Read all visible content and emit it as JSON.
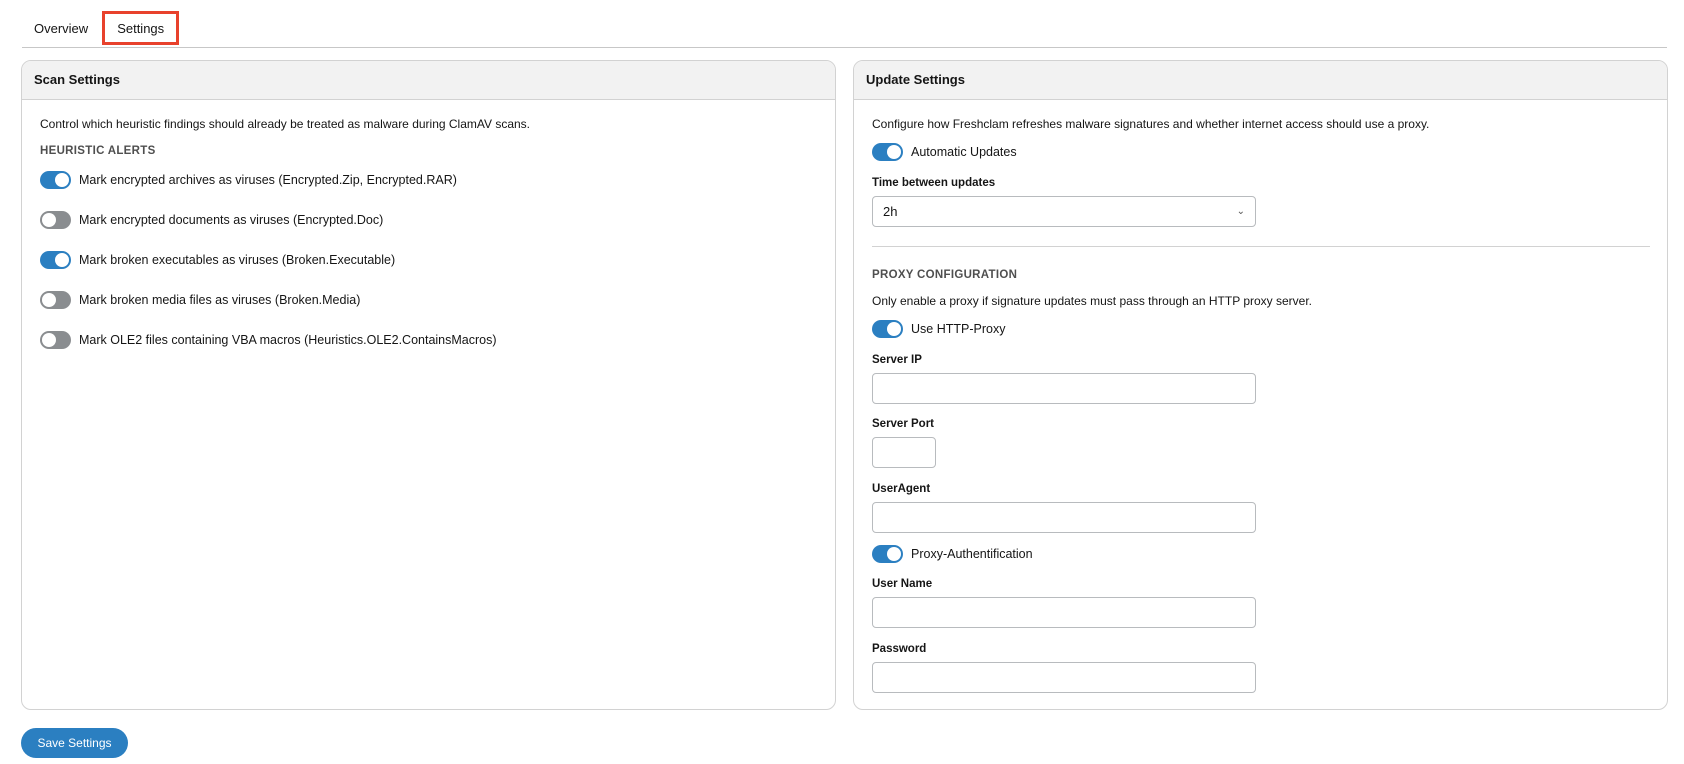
{
  "tabs": [
    {
      "label": "Overview",
      "active": false
    },
    {
      "label": "Settings",
      "active": true
    }
  ],
  "scan": {
    "title": "Scan Settings",
    "description": "Control which heuristic findings should already be treated as malware during ClamAV scans.",
    "section_title": "HEURISTIC ALERTS",
    "toggles": [
      {
        "label": "Mark encrypted archives as viruses (Encrypted.Zip, Encrypted.RAR)",
        "on": true
      },
      {
        "label": "Mark encrypted documents as viruses (Encrypted.Doc)",
        "on": false
      },
      {
        "label": "Mark broken executables as viruses (Broken.Executable)",
        "on": true
      },
      {
        "label": "Mark broken media files as viruses (Broken.Media)",
        "on": false
      },
      {
        "label": "Mark OLE2 files containing VBA macros (Heuristics.OLE2.ContainsMacros)",
        "on": false
      }
    ]
  },
  "update": {
    "title": "Update Settings",
    "description": "Configure how Freshclam refreshes malware signatures and whether internet access should use a proxy.",
    "auto_updates_label": "Automatic Updates",
    "auto_updates_on": true,
    "interval_label": "Time between updates",
    "interval_value": "2h",
    "proxy_section_title": "PROXY CONFIGURATION",
    "proxy_description": "Only enable a proxy if signature updates must pass through an HTTP proxy server.",
    "use_proxy_label": "Use HTTP-Proxy",
    "use_proxy_on": true,
    "server_ip_label": "Server IP",
    "server_ip_value": "",
    "server_port_label": "Server Port",
    "server_port_value": "",
    "user_agent_label": "UserAgent",
    "user_agent_value": "",
    "proxy_auth_label": "Proxy-Authentification",
    "proxy_auth_on": true,
    "username_label": "User Name",
    "username_value": "",
    "password_label": "Password",
    "password_value": ""
  },
  "save_label": "Save Settings",
  "colors": {
    "accent": "#2b7fc1",
    "toggle_off": "#8a8d90",
    "active_tab_highlight": "#e8412c"
  }
}
